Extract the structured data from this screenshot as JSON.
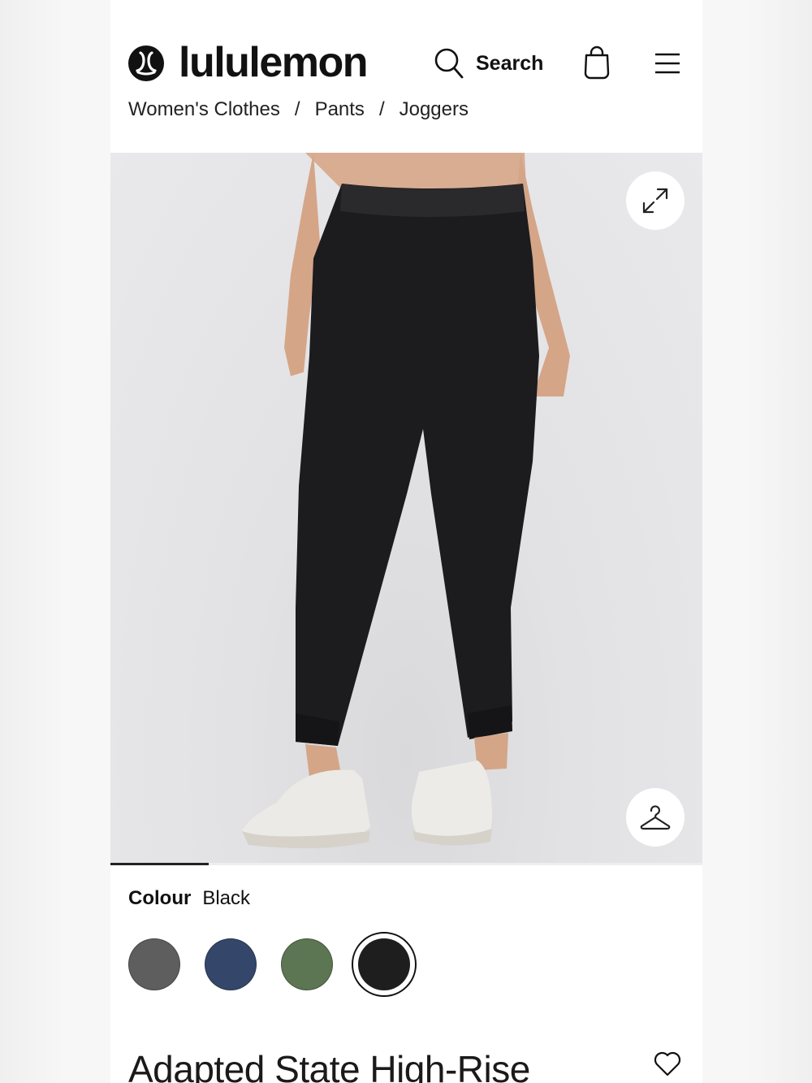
{
  "header": {
    "brand": "lululemon",
    "search_label": "Search"
  },
  "breadcrumb": {
    "items": [
      "Women's Clothes",
      "Pants",
      "Joggers"
    ],
    "separator": "/"
  },
  "product_image": {
    "alt": "Black high-rise jogger pants worn with white sneakers",
    "gallery_progress": 0.166
  },
  "colour": {
    "label": "Colour",
    "selected": "Black",
    "swatches": [
      {
        "name": "Grey",
        "color": "#5e5e5e"
      },
      {
        "name": "Navy",
        "color": "#34476a"
      },
      {
        "name": "Green",
        "color": "#5c7552"
      },
      {
        "name": "Black",
        "color": "#1e1e1e",
        "selected": true
      }
    ]
  },
  "product": {
    "title": "Adapted State High-Rise"
  },
  "icons": {
    "logo": "lululemon-logo-icon",
    "search": "search-icon",
    "bag": "shopping-bag-icon",
    "menu": "hamburger-menu-icon",
    "expand": "expand-icon",
    "hanger": "hanger-icon",
    "wishlist": "heart-icon"
  }
}
